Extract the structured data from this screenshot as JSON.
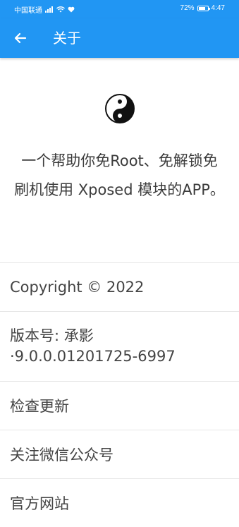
{
  "status_bar": {
    "carrier": "中国联通",
    "battery": "72%",
    "battery_level": 0.72,
    "time": "4:47"
  },
  "app_bar": {
    "title": "关于"
  },
  "hero": {
    "logo_icon": "yin-yang-icon",
    "description": "一个帮助你免Root、免解锁免刷机使用 Xposed 模块的APP。"
  },
  "menu": {
    "copyright": "Copyright © 2022",
    "version": "版本号: 承影·9.0.0.01201725-6997",
    "check_update": "检查更新",
    "follow_wechat": "关注微信公众号",
    "website": "官方网站"
  },
  "colors": {
    "primary": "#2196f3",
    "text": "#444444",
    "divider": "#e6e6e6"
  }
}
